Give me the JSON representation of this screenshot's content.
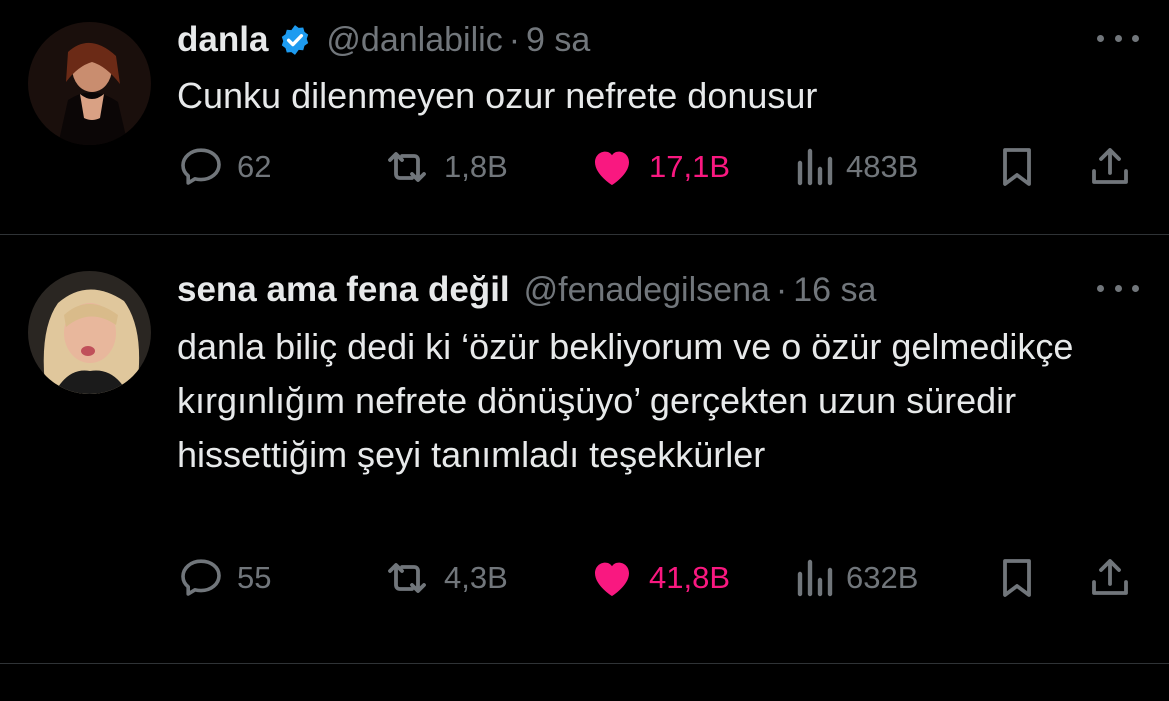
{
  "colors": {
    "background": "#000000",
    "text": "#e7e9ea",
    "muted": "#71767b",
    "like": "#f91880",
    "verified": "#1d9bf0",
    "divider": "#2f3336"
  },
  "tweets": [
    {
      "name": "danla",
      "verified": true,
      "handle": "@danlabilic",
      "separator": "·",
      "time": "9 sa",
      "text": "Cunku dilenmeyen ozur nefrete donusur",
      "replies": "62",
      "retweets": "1,8B",
      "likes": "17,1B",
      "views": "483B",
      "liked": true,
      "icons": [
        "more-icon",
        "reply-icon",
        "retweet-icon",
        "heart-icon",
        "views-icon",
        "bookmark-icon",
        "share-icon"
      ]
    },
    {
      "name": "sena ama fena değil",
      "verified": false,
      "handle": "@fenadegilsena",
      "separator": "·",
      "time": "16 sa",
      "text": "danla biliç dedi ki ‘özür bekliyorum ve o özür gelmedikçe kırgınlığım nefrete dönüşüyo’ gerçekten uzun süredir hissettiğim şeyi tanımladı teşekkürler",
      "replies": "55",
      "retweets": "4,3B",
      "likes": "41,8B",
      "views": "632B",
      "liked": true,
      "icons": [
        "more-icon",
        "reply-icon",
        "retweet-icon",
        "heart-icon",
        "views-icon",
        "bookmark-icon",
        "share-icon"
      ]
    }
  ]
}
